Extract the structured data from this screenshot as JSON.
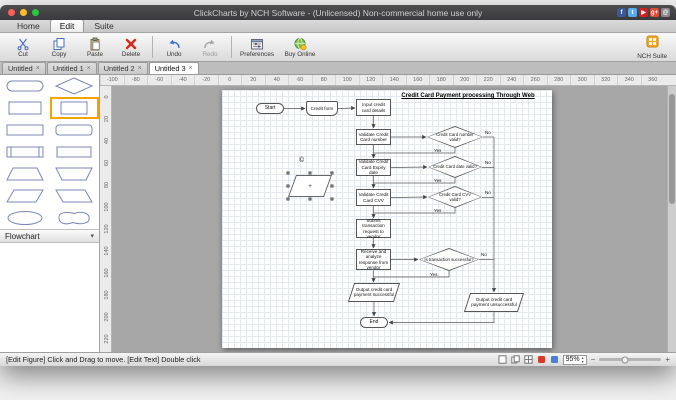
{
  "titlebar": {
    "title": "ClickCharts by NCH Software - (Unlicensed) Non-commercial home use only",
    "social": [
      {
        "name": "facebook",
        "glyph": "f",
        "color": "#3b5998"
      },
      {
        "name": "twitter",
        "glyph": "t",
        "color": "#55acee"
      },
      {
        "name": "youtube",
        "glyph": "▶",
        "color": "#cd201f"
      },
      {
        "name": "googleplus",
        "glyph": "g+",
        "color": "#dd4b39"
      },
      {
        "name": "mail",
        "glyph": "@",
        "color": "#8a8a8a"
      }
    ]
  },
  "ribbon": {
    "tabs": [
      "Home",
      "Edit",
      "Suite"
    ],
    "active": "Edit"
  },
  "toolbar": {
    "buttons": [
      {
        "id": "cut",
        "label": "Cut"
      },
      {
        "id": "copy",
        "label": "Copy"
      },
      {
        "id": "paste",
        "label": "Paste"
      },
      {
        "id": "delete",
        "label": "Delete"
      },
      {
        "id": "undo",
        "label": "Undo"
      },
      {
        "id": "redo",
        "label": "Redo",
        "disabled": true
      },
      {
        "id": "preferences",
        "label": "Preferences"
      },
      {
        "id": "buy-online",
        "label": "Buy Online"
      }
    ],
    "suite_label": "NCH Suite"
  },
  "doc_tabs": [
    {
      "label": "Untitled"
    },
    {
      "label": "Untitled 1"
    },
    {
      "label": "Untitled 2"
    },
    {
      "label": "Untitled 3",
      "active": true
    }
  ],
  "ui": {
    "close_glyph": "×",
    "caret_down": "▾",
    "stepper_up": "▴",
    "stepper_down": "▾",
    "minus": "−",
    "plus": "+"
  },
  "shape_panel": {
    "category": "Flowchart",
    "shapes": [
      "terminator",
      "decision",
      "process",
      "process-selected",
      "process-wide",
      "rounded-process",
      "predefined-process",
      "process-2",
      "trapezoid",
      "inverted-trapezoid",
      "parallelogram",
      "parallelogram-mirrored",
      "ellipse",
      "blob"
    ]
  },
  "rulers": {
    "horizontal": [
      -100,
      -80,
      -60,
      -40,
      -20,
      0,
      20,
      40,
      60,
      80,
      100,
      120,
      140,
      160,
      180,
      200,
      220,
      240,
      260,
      280,
      300,
      320,
      340,
      360
    ],
    "vertical": [
      0,
      20,
      40,
      60,
      80,
      100,
      120,
      140,
      160,
      180,
      200,
      220
    ]
  },
  "flowchart": {
    "title": "Credit Card Payment processing Through Web",
    "nodes": {
      "start": "Start",
      "credit_form": "Credit form",
      "input": "Input credit card details",
      "validate_number": "Validate Credit Card number",
      "number_valid": "Credit Card number valid?",
      "validate_expiry": "Validate Credit Card Expiry date",
      "date_valid": "Credit Card date valid?",
      "validate_cvv": "Validate Credit Card CVV",
      "cvv_valid": "Credit Card CVV valid?",
      "submit": "Submit transaction request to vendor",
      "receive": "Receive and analyze response from vendor",
      "txn_success": "Is transaction successful?",
      "output_success": "Output credit card payment successful",
      "output_fail": "Output credit card payment unsuccessful",
      "end": "End"
    },
    "labels": {
      "yes": "Yes",
      "no": "No"
    },
    "copyright": "©"
  },
  "statusbar": {
    "hint": "[Edit Figure] Click and Drag to move. [Edit Text] Double click",
    "zoom": "95%"
  }
}
